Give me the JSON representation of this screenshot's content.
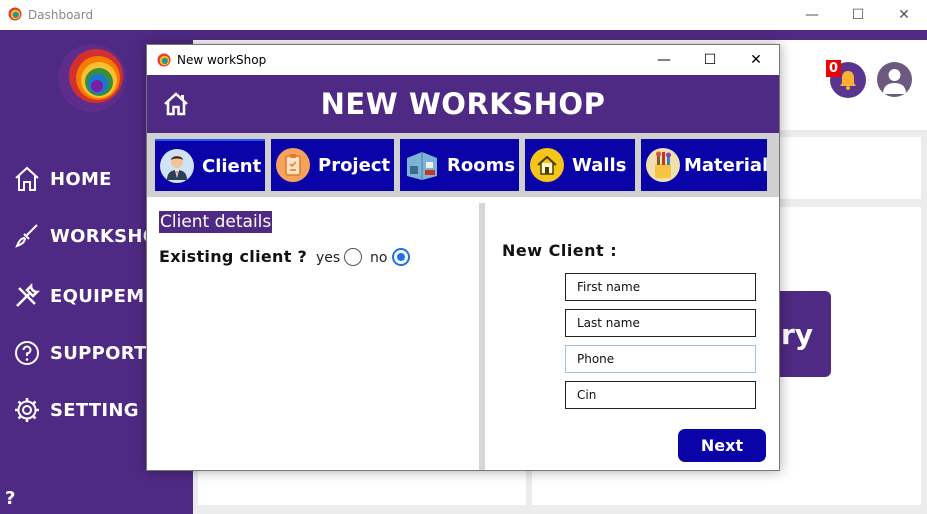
{
  "window": {
    "title": "Dashboard"
  },
  "sidebar": {
    "items": [
      {
        "label": "HOME",
        "icon": "home-icon"
      },
      {
        "label": "WORKSHOP",
        "icon": "brush-icon"
      },
      {
        "label": "EQUIPEMENT",
        "icon": "tools-icon"
      },
      {
        "label": "SUPPORT",
        "icon": "help-icon"
      },
      {
        "label": "SETTING",
        "icon": "gear-icon"
      }
    ],
    "help_label": "?"
  },
  "topbar": {
    "notification_count": "0"
  },
  "main": {
    "history_label": "ry"
  },
  "modal": {
    "title": "New workShop",
    "heading": "NEW WORKSHOP",
    "tabs": [
      {
        "label": "Client",
        "icon": "client-avatar-icon"
      },
      {
        "label": "Project",
        "icon": "clipboard-icon"
      },
      {
        "label": "Rooms",
        "icon": "room-icon"
      },
      {
        "label": "Walls",
        "icon": "house-icon"
      },
      {
        "label": "Material",
        "icon": "paint-brushes-icon"
      }
    ],
    "client_details": {
      "section_title": "Client details",
      "question": "Existing client ?",
      "yes_label": "yes",
      "no_label": "no",
      "selected": "no"
    },
    "new_client": {
      "title": "New Client :",
      "fields": [
        {
          "placeholder": "First name",
          "value": ""
        },
        {
          "placeholder": "Last name",
          "value": ""
        },
        {
          "placeholder": "Phone",
          "value": ""
        },
        {
          "placeholder": "Cin",
          "value": ""
        }
      ],
      "next_label": "Next"
    }
  },
  "colors": {
    "brand_purple": "#4f2a84",
    "tab_blue": "#0a04a8",
    "radio_blue": "#1a73e8",
    "badge_red": "#e00000"
  }
}
